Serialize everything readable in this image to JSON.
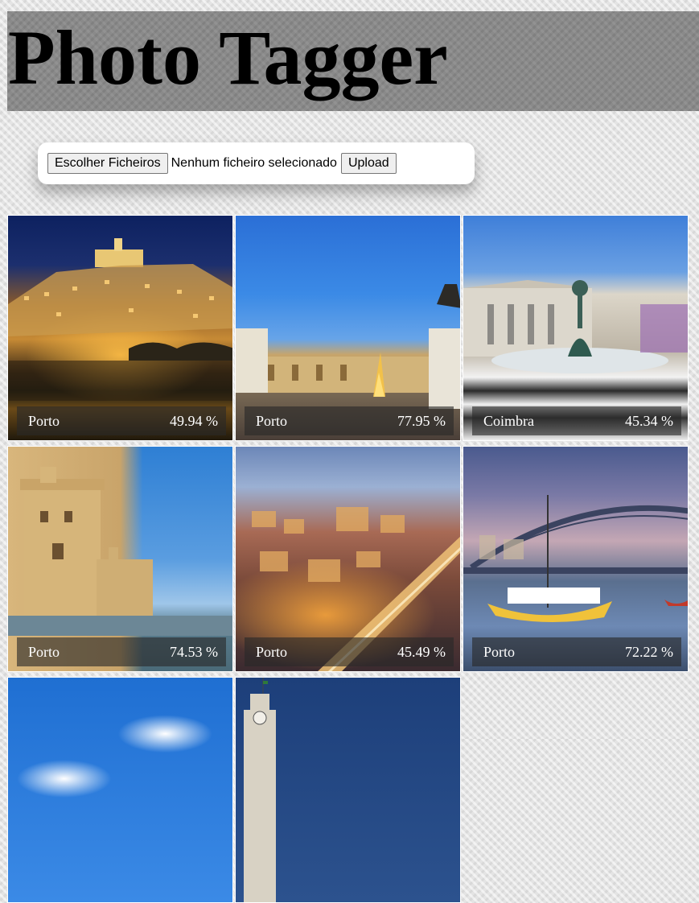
{
  "app": {
    "title": "Photo Tagger"
  },
  "upload": {
    "choose_label": "Escolher Ficheiros",
    "status_text": "Nenhum ficheiro selecionado",
    "upload_label": "Upload"
  },
  "photos": [
    {
      "tag": "Porto",
      "score": "49.94 %",
      "scene": "coimbra-night"
    },
    {
      "tag": "Porto",
      "score": "77.95 %",
      "scene": "square-christmas-tree"
    },
    {
      "tag": "Coimbra",
      "score": "45.34 %",
      "scene": "rossio-fountain"
    },
    {
      "tag": "Porto",
      "score": "74.53 %",
      "scene": "belem-tower"
    },
    {
      "tag": "Porto",
      "score": "45.49 %",
      "scene": "porto-night-bridge"
    },
    {
      "tag": "Porto",
      "score": "72.22 %",
      "scene": "douro-boats"
    },
    {
      "scene": "blue-sky-clouds"
    },
    {
      "scene": "clock-tower-dusk"
    }
  ]
}
